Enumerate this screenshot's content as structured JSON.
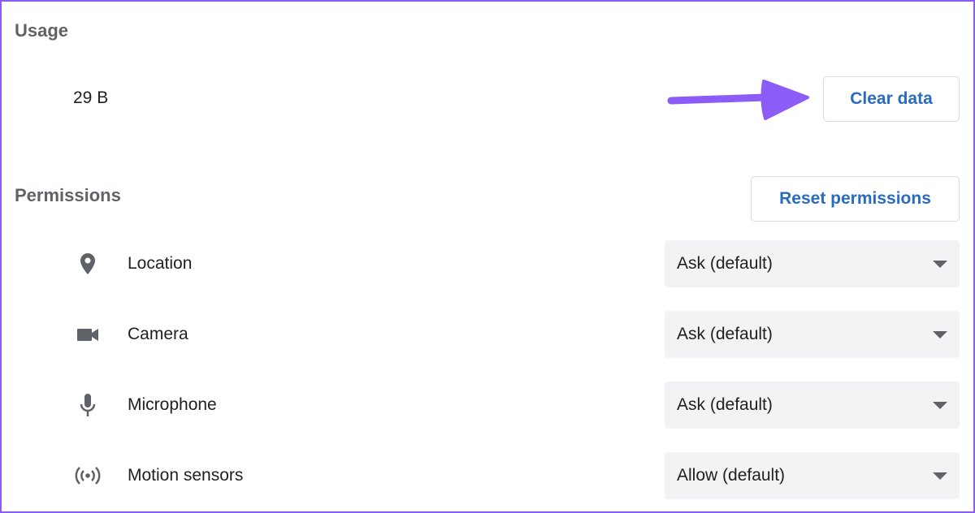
{
  "usage": {
    "heading": "Usage",
    "value": "29 B",
    "clear_button": "Clear data"
  },
  "permissions": {
    "heading": "Permissions",
    "reset_button": "Reset permissions",
    "items": [
      {
        "label": "Location",
        "icon": "location-pin-icon",
        "value": "Ask (default)"
      },
      {
        "label": "Camera",
        "icon": "camera-icon",
        "value": "Ask (default)"
      },
      {
        "label": "Microphone",
        "icon": "microphone-icon",
        "value": "Ask (default)"
      },
      {
        "label": "Motion sensors",
        "icon": "motion-sensors-icon",
        "value": "Allow (default)"
      }
    ]
  },
  "colors": {
    "accent": "#2a6bc2",
    "annotation_arrow": "#8b5cf6",
    "frame": "#8b5cf6"
  }
}
